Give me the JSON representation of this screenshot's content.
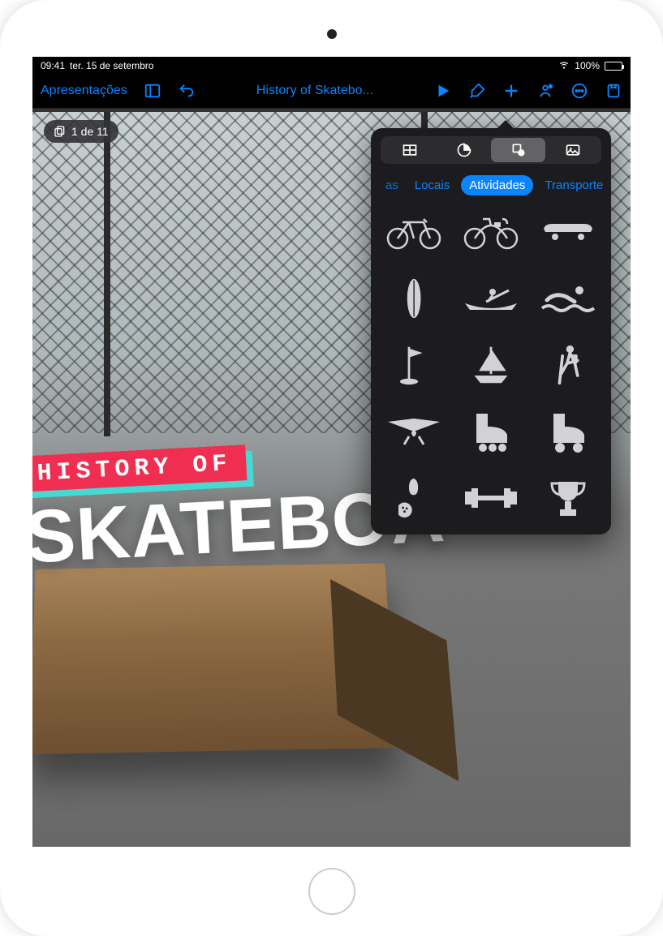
{
  "status": {
    "time": "09:41",
    "date": "ter. 15 de setembro",
    "battery_pct": "100%"
  },
  "toolbar": {
    "back_label": "Apresentações",
    "doc_title": "History of Skatebo..."
  },
  "slide": {
    "counter": "1 de 11",
    "title_small": "HISTORY OF",
    "title_big": "SKATEBOA"
  },
  "popover": {
    "segments": [
      "table",
      "chart",
      "shape",
      "media"
    ],
    "selected_segment": 2,
    "categories": {
      "partial": "as",
      "items": [
        "Locais",
        "Atividades",
        "Transporte"
      ],
      "selected_index": 1
    },
    "shapes": [
      "bicycle",
      "bicycle-cruiser",
      "skateboard",
      "surfboard",
      "rowing",
      "swimming",
      "golf-flag",
      "sailboat",
      "hiking",
      "hang-glider",
      "roller-skate",
      "roller-skate-quad",
      "bowling-pin",
      "dumbbell",
      "trophy"
    ]
  }
}
